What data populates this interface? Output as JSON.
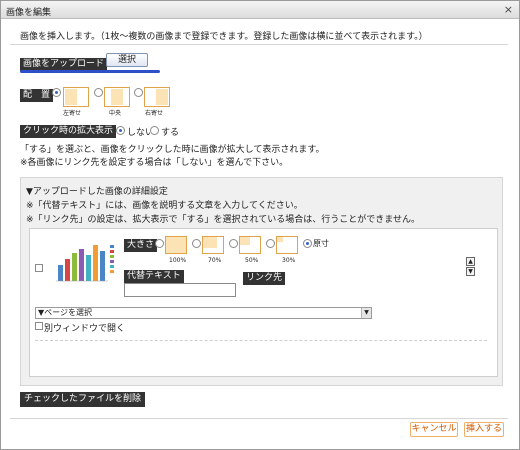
{
  "dialog": {
    "title": "画像を編集",
    "close_glyph": "×"
  },
  "intro": "画像を挿入します。（1枚～複数の画像まで登録できます。登録した画像は横に並べて表示されます。）",
  "upload": {
    "label": "画像をアップロード",
    "select_button": "選択"
  },
  "placement": {
    "label": "配　置",
    "options": [
      "左寄せ",
      "中央",
      "右寄せ"
    ],
    "selected_index": 0
  },
  "enlarge": {
    "label": "クリック時の拡大表示",
    "options": [
      "しない",
      "する"
    ],
    "selected": "しない"
  },
  "notes": [
    "「する」を選ぶと、画像をクリックした時に画像が拡大して表示されます。",
    "※各画像にリンク先を設定する場合は「しない」を選んで下さい。"
  ],
  "details": {
    "heading": "▼アップロードした画像の詳細設定",
    "notes": [
      "※「代替テキスト」には、画像を説明する文章を入力してください。",
      "※「リンク先」の設定は、拡大表示で「する」を選択されている場合は、行うことができません。"
    ]
  },
  "image_item": {
    "size_label": "大きさ",
    "size_options": [
      "100%",
      "70%",
      "50%",
      "30%",
      "原寸"
    ],
    "size_fill_fractions": [
      1.0,
      0.7,
      0.5,
      0.3
    ],
    "size_selected": "原寸",
    "alt_label": "代替テキスト",
    "alt_value": "",
    "link_label": "リンク先",
    "page_select_value": "▼ページを選択",
    "new_window_label": "別ウィンドウで開く",
    "move_up_glyph": "▲",
    "move_down_glyph": "▼",
    "select_arrow_glyph": "▼"
  },
  "delete_checked_button": "チェックしたファイルを削除",
  "footer": {
    "cancel": "キャンセル",
    "insert": "挿入する"
  },
  "colors": {
    "accent_orange": "#d35a00",
    "underline_blue": "#2f4fc9",
    "label_dark": "#333333",
    "option_border": "#e1a24c",
    "option_fill": "#fbe3b6"
  }
}
